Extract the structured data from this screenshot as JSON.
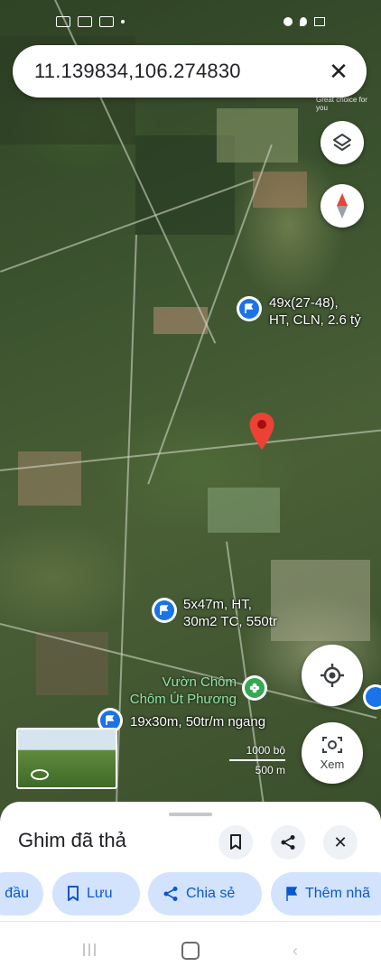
{
  "search": {
    "query": "11.139834,106.274830"
  },
  "map": {
    "pins": [
      {
        "label_line1": "49x(27-48),",
        "label_line2": "HT, CLN, 2.6 tỷ"
      },
      {
        "label_line1": "5x47m, HT,",
        "label_line2": "30m2 TC, 550tr"
      },
      {
        "label_line1": "19x30m, 50tr/m ngang",
        "label_line2": ""
      }
    ],
    "place": {
      "line1": "Vườn Chôm",
      "line2": "Chôm Út Phương"
    },
    "scale": {
      "top": "1000 bộ",
      "bottom": "500 m"
    },
    "streetview_label": "Xem",
    "watermark": "Great choice for you"
  },
  "sheet": {
    "title": "Ghim đã thả",
    "chips": [
      {
        "label": "đầu",
        "icon": "directions-icon"
      },
      {
        "label": "Lưu",
        "icon": "bookmark-icon"
      },
      {
        "label": "Chia sẻ",
        "icon": "share-icon"
      },
      {
        "label": "Thêm nhã",
        "icon": "flag-icon"
      }
    ]
  },
  "colors": {
    "accent": "#1a73e8",
    "pin_red": "#ea4335",
    "chip_bg": "#d3e3fd",
    "chip_text": "#0b57d0",
    "poi_green": "#34a853"
  }
}
